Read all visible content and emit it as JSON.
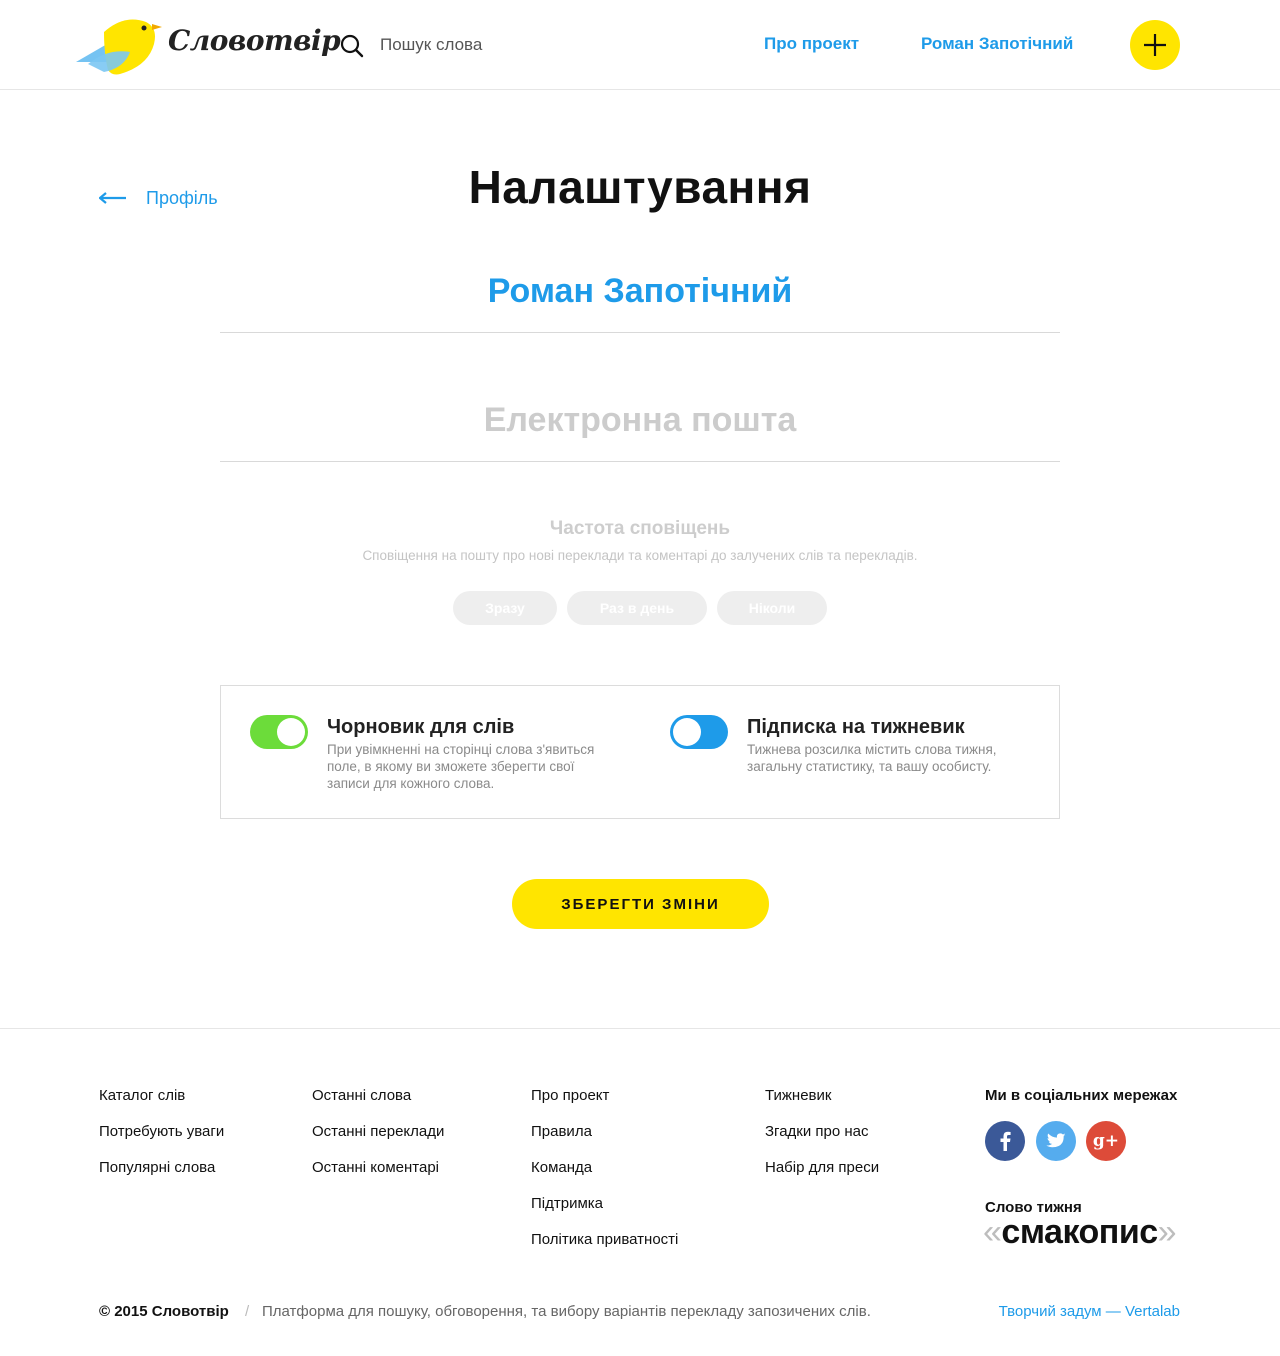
{
  "header": {
    "logo_text": "Словотвір",
    "search_placeholder": "Пошук слова",
    "nav": [
      "Про проект",
      "Роман Запотічний"
    ],
    "add_icon": "plus-icon"
  },
  "page": {
    "back_label": "Профіль",
    "title": "Налаштування",
    "user_name": "Роман Запотічний",
    "email_placeholder": "Електронна пошта",
    "notify": {
      "title": "Частота сповіщень",
      "description": "Сповіщення на пошту про нові переклади та коментарі до залучених слів та перекладів.",
      "options": [
        "Зразу",
        "Раз в день",
        "Ніколи"
      ]
    },
    "options": [
      {
        "title": "Чорновик для слів",
        "description": "При увімкненні на сторінці слова з'явиться поле, в якому ви зможете зберегти свої записи для кожного слова.",
        "enabled": true,
        "color": "#6cdc3a"
      },
      {
        "title": "Підписка на тижневик",
        "description": "Тижнева розсилка містить слова тижня, загальну статистику, та вашу особисту.",
        "enabled": false,
        "color": "#1e9be9"
      }
    ],
    "save_label": "ЗБЕРЕГТИ ЗМІНИ"
  },
  "footer": {
    "col1": [
      "Каталог слів",
      "Потребують уваги",
      "Популярні слова"
    ],
    "col2": [
      "Останні слова",
      "Останні переклади",
      "Останні коментарі"
    ],
    "col3": [
      "Про проект",
      "Правила",
      "Команда",
      "Підтримка",
      "Політика приватності"
    ],
    "col4": [
      "Тижневик",
      "Згадки про нас",
      "Набір для преси"
    ],
    "social_title": "Ми в соціальних мережах",
    "social": [
      {
        "icon": "facebook-icon",
        "glyph": "f",
        "color": "#3b5998"
      },
      {
        "icon": "twitter-icon",
        "glyph": "🐦",
        "color": "#55acee"
      },
      {
        "icon": "google-plus-icon",
        "glyph": "g+",
        "color": "#dd4b39"
      }
    ],
    "word_of_week_label": "Слово тижня",
    "word_of_week": "смакопис",
    "copyright": "© 2015 Словотвір",
    "separator": "/",
    "tagline": "Платформа для пошуку, обговорення, та вибору варіантів перекладу запозичених слів.",
    "credit": "Творчий задум — Vertalab"
  },
  "colors": {
    "accent": "#1e9be9",
    "yellow": "#ffe500",
    "green": "#6cdc3a"
  }
}
